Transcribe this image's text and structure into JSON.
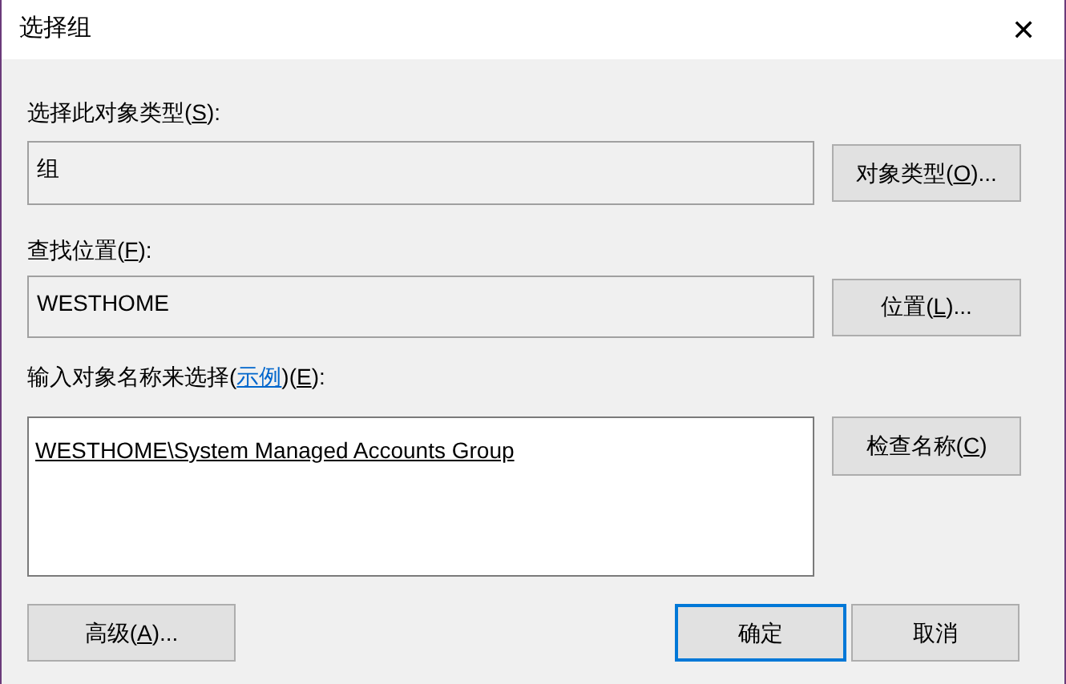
{
  "window": {
    "title": "选择组",
    "close": "✕"
  },
  "object_type": {
    "label": {
      "before": "选择此对象类型(",
      "key": "S",
      "after": "):"
    },
    "value": "组",
    "button": {
      "before": "对象类型(",
      "key": "O",
      "after": ")..."
    }
  },
  "location": {
    "label": {
      "before": "查找位置(",
      "key": "F",
      "after": "):"
    },
    "value": "WESTHOME",
    "button": {
      "before": "位置(",
      "key": "L",
      "after": ")..."
    }
  },
  "names": {
    "label": {
      "before": "输入对象名称来选择(",
      "link": "示例",
      "middle": ")(",
      "key": "E",
      "after": "):"
    },
    "value": "WESTHOME\\System Managed Accounts Group",
    "button": {
      "before": "检查名称(",
      "key": "C",
      "after": ")"
    }
  },
  "buttons": [
    {
      "kind": "advanced",
      "before": "高级(",
      "key": "A",
      "after": ")...",
      "default": false
    },
    {
      "kind": "ok",
      "before": "确定",
      "default": true
    },
    {
      "kind": "cancel",
      "before": "取消",
      "default": false
    }
  ]
}
